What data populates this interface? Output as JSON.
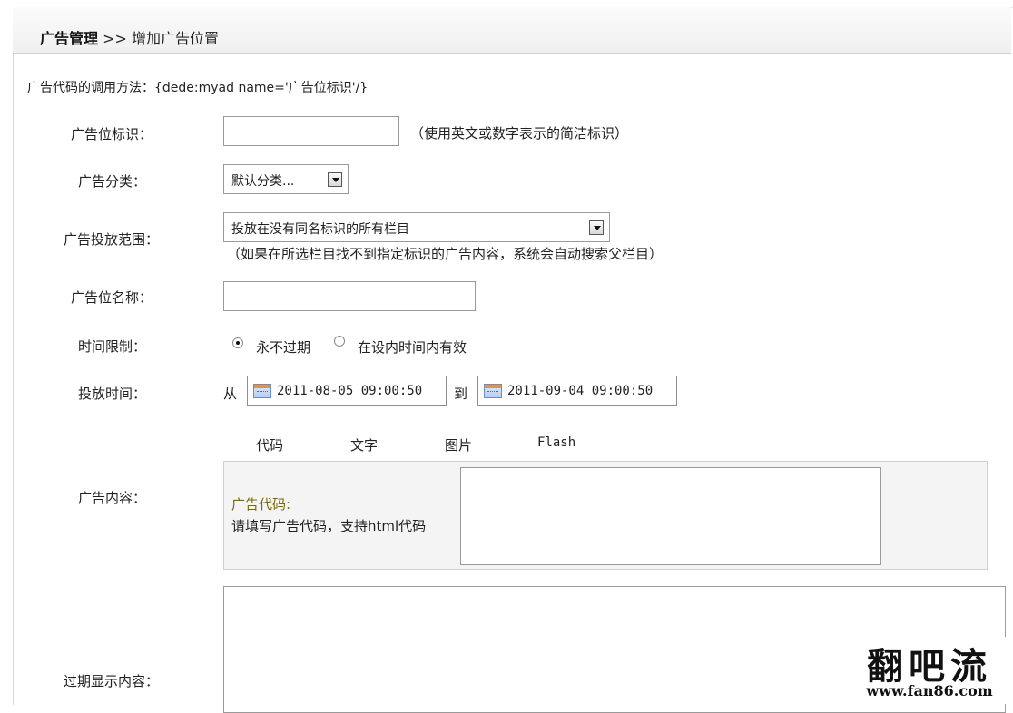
{
  "breadcrumb": {
    "root": "广告管理",
    "sep": ">>",
    "current": "增加广告位置"
  },
  "usage_hint": "广告代码的调用方法：{dede:myad name='广告位标识'/}",
  "form": {
    "tag": {
      "label": "广告位标识：",
      "value": "",
      "hint": "（使用英文或数字表示的简洁标识）"
    },
    "category": {
      "label": "广告分类：",
      "selected": "默认分类..."
    },
    "scope": {
      "label": "广告投放范围：",
      "selected": "投放在没有同名标识的所有栏目",
      "hint": "（如果在所选栏目找不到指定标识的广告内容，系统会自动搜索父栏目）"
    },
    "name": {
      "label": "广告位名称：",
      "value": ""
    },
    "time_limit": {
      "label": "时间限制：",
      "option_never": "永不过期",
      "option_within": "在设内时间内有效",
      "selected": "never"
    },
    "time": {
      "label": "投放时间：",
      "from_label": "从",
      "from": "2011-08-05 09:00:50",
      "to_label": "到",
      "to": "2011-09-04 09:00:50"
    },
    "content": {
      "label": "广告内容：",
      "tabs": [
        "代码",
        "文字",
        "图片",
        "Flash"
      ],
      "code_title": "广告代码:",
      "code_desc": "请填写广告代码，支持html代码",
      "value": ""
    },
    "expired": {
      "label": "过期显示内容：",
      "value": ""
    }
  },
  "watermark": {
    "text": "翻吧流",
    "url": "www.fan86.com"
  },
  "colors": {
    "code_title": "#7a6a00",
    "header_bg": "#f3f3f3",
    "border": "#cfcfcf"
  }
}
